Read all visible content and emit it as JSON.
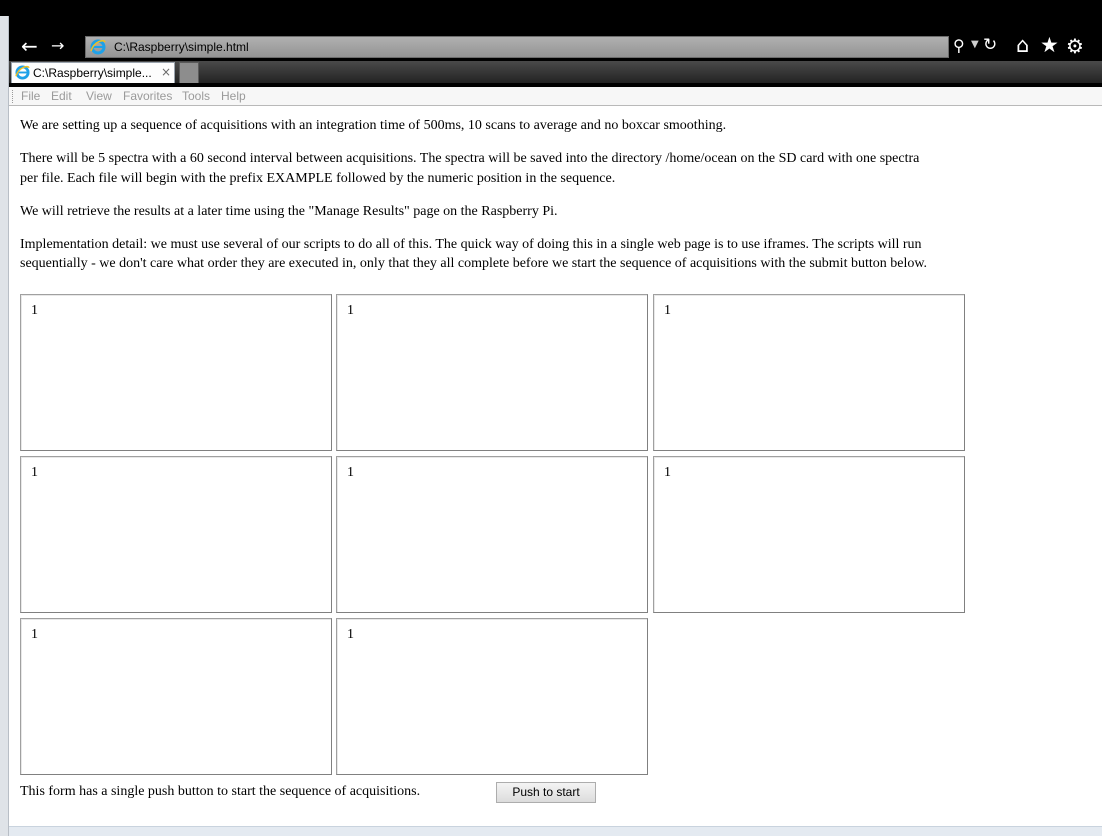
{
  "browser": {
    "address": "C:\\Raspberry\\simple.html",
    "tab_title": "C:\\Raspberry\\simple...",
    "tab_close": "×",
    "menu": [
      "File",
      "Edit",
      "View",
      "Favorites",
      "Tools",
      "Help"
    ],
    "icons": [
      "back-arrow-icon",
      "forward-arrow-icon",
      "ie-logo-icon",
      "search-icon",
      "dropdown-icon",
      "refresh-icon",
      "home-icon",
      "star-icon",
      "gear-icon"
    ]
  },
  "content": {
    "paragraphs": [
      "We are setting up a sequence of acquisitions with an integration time of 500ms, 10 scans to average and no boxcar smoothing.",
      "There will be 5 spectra with a 60 second interval between acquisitions. The spectra will be saved into the directory /home/ocean on the SD card with one spectra",
      "per file. Each file will begin with the prefix EXAMPLE followed by the numeric position in the sequence.",
      "We will retrieve the results at a later time using the \"Manage Results\" page on the Raspberry Pi.",
      "Implementation detail: we must use several of our scripts to do all of this. The quick way of doing this in a single web page is to use iframes. The scripts will run",
      "sequentially - we don't care what order they are executed in, only that they all complete before we start the sequence of acquisitions with the submit button below."
    ],
    "iframes": [
      "1",
      "1",
      "1",
      "1",
      "1",
      "1",
      "1",
      "1"
    ],
    "form_text": "This form has a single push button to start the sequence of acquisitions.",
    "button_label": "Push to start"
  }
}
